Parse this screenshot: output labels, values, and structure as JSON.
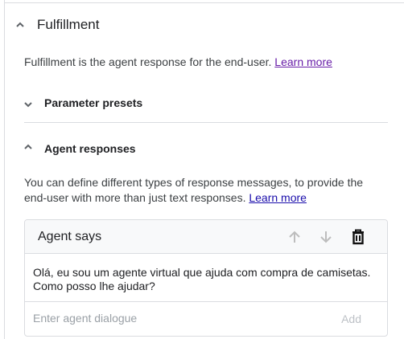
{
  "section": {
    "title": "Fulfillment",
    "description": "Fulfillment is the agent response for the end-user.",
    "learn_more": "Learn more"
  },
  "parameter_presets": {
    "label": "Parameter presets"
  },
  "agent_responses": {
    "label": "Agent responses",
    "description": "You can define different types of response messages, to provide the end-user with more than just text responses.",
    "learn_more": "Learn more"
  },
  "card": {
    "title": "Agent says",
    "message": "Olá, eu sou um agente virtual que ajuda com compra de camisetas. Como posso lhe ajudar?",
    "input_placeholder": "Enter agent dialogue",
    "input_value": "",
    "add_label": "Add"
  },
  "colors": {
    "visited_link": "#681da8",
    "link": "#1a0dab"
  }
}
